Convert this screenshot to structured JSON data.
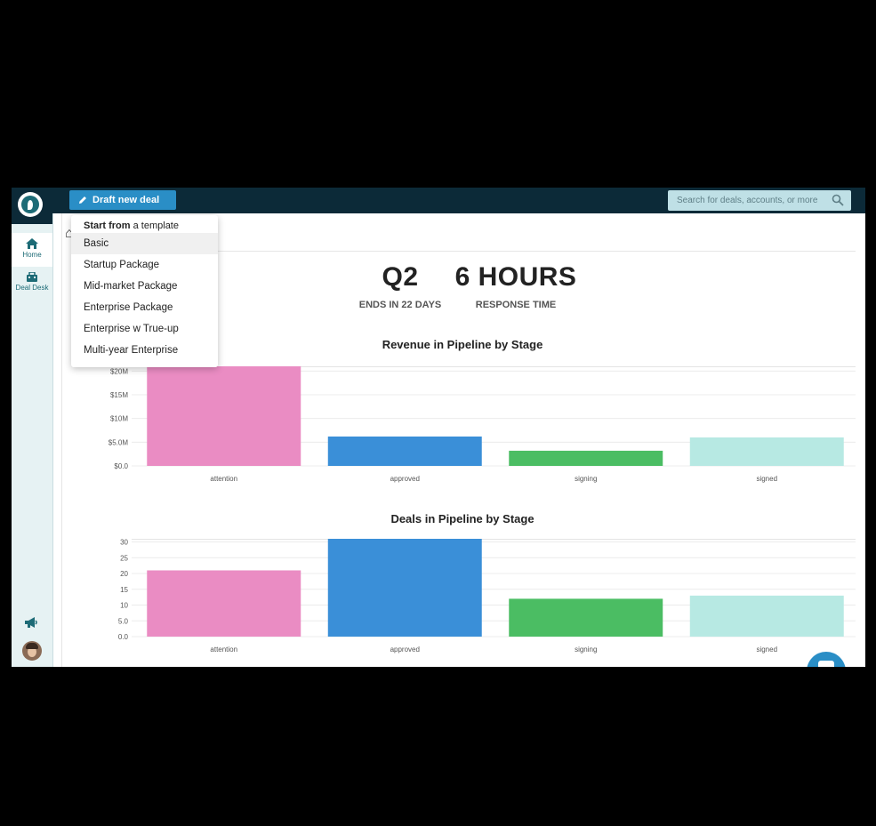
{
  "topbar": {
    "draft_button_label": "Draft new deal",
    "search_placeholder": "Search for deals, accounts, or more"
  },
  "sidebar": {
    "items": [
      {
        "label": "Home",
        "icon": "home-icon"
      },
      {
        "label": "Deal Desk",
        "icon": "deal-desk-icon"
      }
    ],
    "footer_icons": [
      "megaphone-icon",
      "avatar"
    ]
  },
  "dropdown": {
    "heading_bold": "Start from",
    "heading_rest": " a template",
    "items": [
      "Basic",
      "Startup Package",
      "Mid-market Package",
      "Enterprise Package",
      "Enterprise w True-up",
      "Multi-year Enterprise"
    ]
  },
  "kpis": [
    {
      "value": "Q2",
      "label": "ENDS IN 22 DAYS"
    },
    {
      "value": "6 HOURS",
      "label": "RESPONSE TIME"
    }
  ],
  "colors": {
    "navy": "#0c2a38",
    "accent": "#2a8ec6",
    "attention": "#ea8cc3",
    "approved": "#3a8fd8",
    "signing": "#4bbd63",
    "signed": "#b7e9e3"
  },
  "chart_data": [
    {
      "type": "bar",
      "title": "Revenue in Pipeline by Stage",
      "categories": [
        "attention",
        "approved",
        "signing",
        "signed"
      ],
      "values": [
        21000000,
        6200000,
        3200000,
        6000000
      ],
      "yticks": [
        "$0.0",
        "$5.0M",
        "$10M",
        "$15M",
        "$20M"
      ],
      "ylim": [
        0,
        21000000
      ],
      "grid": true
    },
    {
      "type": "bar",
      "title": "Deals in Pipeline by Stage",
      "categories": [
        "attention",
        "approved",
        "signing",
        "signed"
      ],
      "values": [
        21,
        31,
        12,
        13
      ],
      "yticks": [
        "0.0",
        "5.0",
        "10",
        "15",
        "20",
        "25",
        "30"
      ],
      "ylim": [
        0,
        31
      ],
      "grid": true
    }
  ]
}
